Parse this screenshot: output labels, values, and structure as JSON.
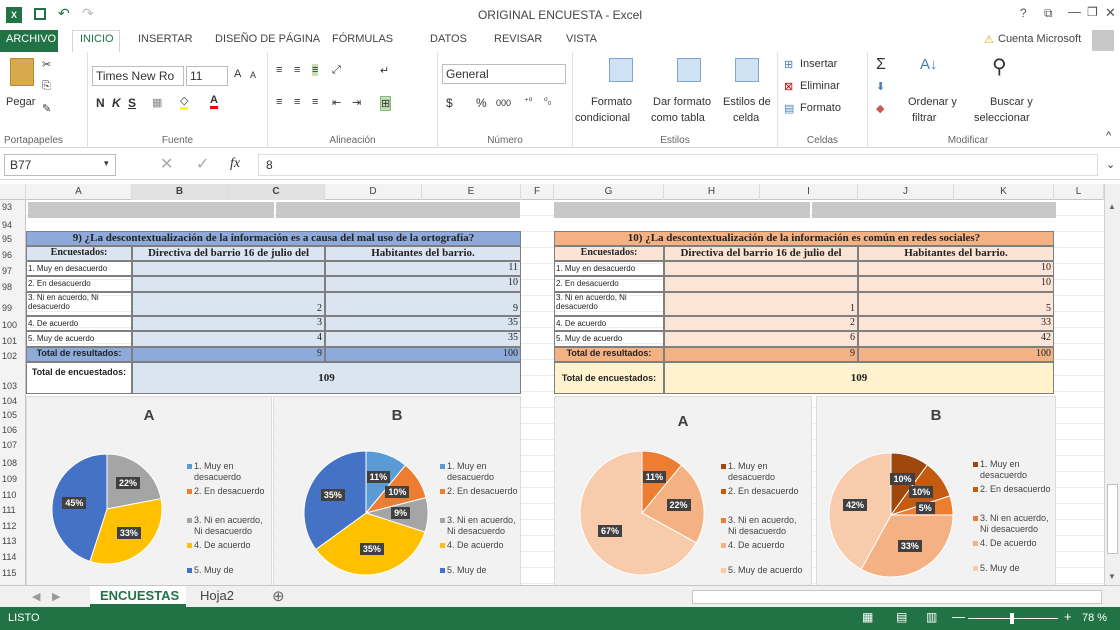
{
  "window": {
    "title": "ORIGINAL ENCUESTA - Excel",
    "account": "Cuenta Microsoft"
  },
  "tabs": [
    "ARCHIVO",
    "INICIO",
    "INSERTAR",
    "DISEÑO DE PÁGINA",
    "FÓRMULAS",
    "DATOS",
    "REVISAR",
    "VISTA"
  ],
  "ribbon": {
    "paste": "Pegar",
    "clipboard": "Portapapeles",
    "font_name": "Times New Ro",
    "font_size": "11",
    "bold": "N",
    "italic": "K",
    "underline": "S",
    "font_group": "Fuente",
    "align_group": "Alineación",
    "number_format": "General",
    "currency": "$",
    "percent": "%",
    "thousands": "000",
    "number_group": "Número",
    "cond_format": "Formato",
    "cond_format2": "condicional",
    "table_format": "Dar formato",
    "table_format2": "como tabla",
    "cell_styles": "Estilos de",
    "cell_styles2": "celda",
    "styles_group": "Estilos",
    "insert": "Insertar",
    "delete": "Eliminar",
    "format": "Formato",
    "cells_group": "Celdas",
    "sort": "Ordenar y",
    "sort2": "filtrar",
    "find": "Buscar y",
    "find2": "seleccionar",
    "edit_group": "Modificar"
  },
  "formula_bar": {
    "name_box": "B77",
    "value": "8",
    "fx": "fx"
  },
  "columns": [
    "A",
    "B",
    "C",
    "D",
    "E",
    "F",
    "G",
    "H",
    "I",
    "J",
    "K",
    "L"
  ],
  "rows": [
    "93",
    "94",
    "95",
    "96",
    "97",
    "98",
    "99",
    "100",
    "101",
    "102",
    "103",
    "104",
    "105",
    "106",
    "107",
    "108",
    "109",
    "110",
    "111",
    "112",
    "113",
    "114",
    "115"
  ],
  "table1": {
    "title": "9) ¿La descontextualización de la información es a causa del mal uso de la ortografía?",
    "h1": "Encuestados:",
    "h2": "Directiva del barrio 16 de julio del",
    "h3": "Habitantes del barrio.",
    "rows": [
      {
        "label": "1. Muy en desacuerdo",
        "d": "",
        "h": "11"
      },
      {
        "label": "2. En desacuerdo",
        "d": "",
        "h": "10"
      },
      {
        "label": "3. Ni en acuerdo, Ni desacuerdo",
        "d": "2",
        "h": "9"
      },
      {
        "label": "4. De acuerdo",
        "d": "3",
        "h": "35"
      },
      {
        "label": "5. Muy de acuerdo",
        "d": "4",
        "h": "35"
      }
    ],
    "total_label": "Total de resultados:",
    "total_d": "9",
    "total_h": "100",
    "enc_label": "Total de encuestados:",
    "enc_value": "109"
  },
  "table2": {
    "title": "10) ¿La descontextualización de la información es común en redes sociales?",
    "h1": "Encuestados:",
    "h2": "Directiva del barrio 16 de julio del",
    "h3": "Habitantes del barrio.",
    "rows": [
      {
        "label": "1. Muy en desacuerdo",
        "d": "",
        "h": "10"
      },
      {
        "label": "2. En desacuerdo",
        "d": "",
        "h": "10"
      },
      {
        "label": "3. Ni en acuerdo, Ni desacuerdo",
        "d": "1",
        "h": "5"
      },
      {
        "label": "4. De acuerdo",
        "d": "2",
        "h": "33"
      },
      {
        "label": "5. Muy de acuerdo",
        "d": "6",
        "h": "42"
      }
    ],
    "total_label": "Total de resultados:",
    "total_d": "9",
    "total_h": "100",
    "enc_label": "Total de encuestados:",
    "enc_value": "109"
  },
  "chart_data": [
    {
      "type": "pie",
      "title": "A",
      "categories": [
        "1. Muy en desacuerdo",
        "2. En desacuerdo",
        "3. Ni en acuerdo, Ni desacuerdo",
        "4. De acuerdo",
        "5. Muy de"
      ],
      "values": [
        0,
        0,
        22,
        33,
        45
      ],
      "labels": [
        "22%",
        "33%",
        "45%"
      ],
      "colors": [
        "#5b9bd5",
        "#ed7d31",
        "#a5a5a5",
        "#ffc000",
        "#4472c4"
      ]
    },
    {
      "type": "pie",
      "title": "B",
      "categories": [
        "1. Muy en desacuerdo",
        "2. En desacuerdo",
        "3. Ni en acuerdo, Ni desacuerdo",
        "4. De acuerdo",
        "5. Muy de"
      ],
      "values": [
        11,
        10,
        9,
        35,
        35
      ],
      "labels": [
        "11%",
        "10%",
        "9%",
        "35%",
        "35%"
      ],
      "colors": [
        "#5b9bd5",
        "#ed7d31",
        "#a5a5a5",
        "#ffc000",
        "#4472c4"
      ]
    },
    {
      "type": "pie",
      "title": "A",
      "categories": [
        "1. Muy en desacuerdo",
        "2. En desacuerdo",
        "3. Ni en acuerdo, Ni desacuerdo",
        "4. De acuerdo",
        "5. Muy de acuerdo"
      ],
      "values": [
        0,
        0,
        11,
        22,
        67
      ],
      "labels": [
        "11%",
        "22%",
        "67%"
      ],
      "colors": [
        "#9e480e",
        "#c55a11",
        "#ed7d31",
        "#f4b183",
        "#f8cbad"
      ]
    },
    {
      "type": "pie",
      "title": "B",
      "categories": [
        "1. Muy en desacuerdo",
        "2. En desacuerdo",
        "3. Ni en acuerdo, Ni desacuerdo",
        "4. De acuerdo",
        "5. Muy de"
      ],
      "values": [
        10,
        10,
        5,
        33,
        42
      ],
      "labels": [
        "10%",
        "10%",
        "5%",
        "33%",
        "42%"
      ],
      "colors": [
        "#9e480e",
        "#c55a11",
        "#ed7d31",
        "#f4b183",
        "#f8cbad"
      ]
    }
  ],
  "legend_text": [
    "1. Muy en",
    "desacuerdo",
    "2. En desacuerdo",
    "3. Ni en acuerdo,",
    "Ni desacuerdo",
    "4. De acuerdo",
    "5. Muy de",
    "5. Muy de acuerdo"
  ],
  "sheets": [
    "ENCUESTAS",
    "Hoja2"
  ],
  "status": {
    "mode": "LISTO",
    "zoom": "78 %"
  }
}
